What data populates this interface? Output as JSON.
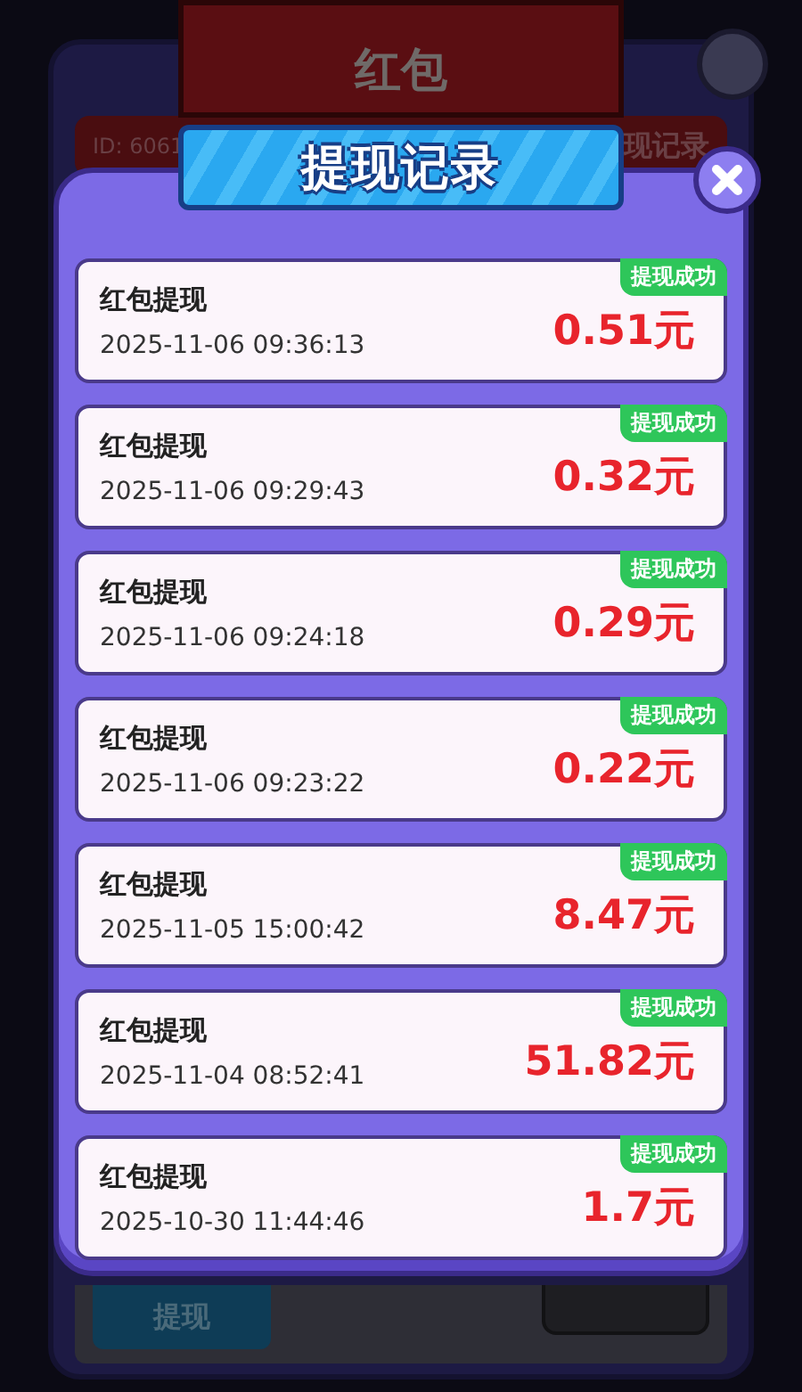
{
  "background_dialog": {
    "title": "红包",
    "user_id": "ID: 6061",
    "records_link": "现记录",
    "withdraw_button": "提现"
  },
  "modal": {
    "title": "提现记录",
    "records": [
      {
        "label": "红包提现",
        "time": "2025-11-06 09:36:13",
        "amount": "0.51元",
        "status": "提现成功"
      },
      {
        "label": "红包提现",
        "time": "2025-11-06 09:29:43",
        "amount": "0.32元",
        "status": "提现成功"
      },
      {
        "label": "红包提现",
        "time": "2025-11-06 09:24:18",
        "amount": "0.29元",
        "status": "提现成功"
      },
      {
        "label": "红包提现",
        "time": "2025-11-06 09:23:22",
        "amount": "0.22元",
        "status": "提现成功"
      },
      {
        "label": "红包提现",
        "time": "2025-11-05 15:00:42",
        "amount": "8.47元",
        "status": "提现成功"
      },
      {
        "label": "红包提现",
        "time": "2025-11-04 08:52:41",
        "amount": "51.82元",
        "status": "提现成功"
      },
      {
        "label": "红包提现",
        "time": "2025-10-30 11:44:46",
        "amount": "1.7元",
        "status": "提现成功"
      }
    ]
  }
}
